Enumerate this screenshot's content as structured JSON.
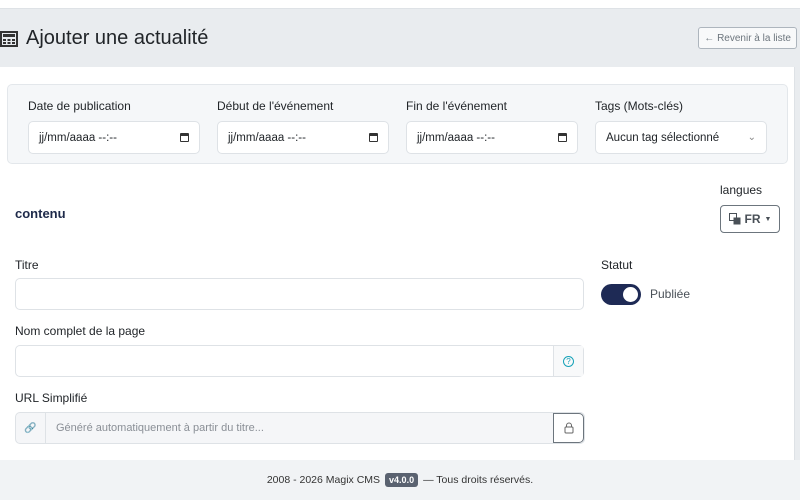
{
  "header": {
    "title": "Ajouter une actualité",
    "back_label": "← Revenir à la liste"
  },
  "filters": [
    {
      "label": "Date de publication",
      "value": "jj/mm/aaaa --:--",
      "icon": "calendar-icon"
    },
    {
      "label": "Début de l'événement",
      "value": "jj/mm/aaaa --:--",
      "icon": "calendar-icon"
    },
    {
      "label": "Fin de l'événement",
      "value": "jj/mm/aaaa --:--",
      "icon": "calendar-icon"
    },
    {
      "label": "Tags (Mots-clés)",
      "value": "Aucun tag sélectionné",
      "icon": "chevron-down-icon"
    }
  ],
  "content": {
    "section_title": "contenu",
    "languages_label": "langues",
    "language": "FR",
    "title_label": "Titre",
    "title_value": "",
    "fullname_label": "Nom complet de la page",
    "fullname_value": "",
    "url_label": "URL Simplifié",
    "url_placeholder": "Généré automatiquement à partir du titre...",
    "status_label": "Statut",
    "status_value": "Publiée",
    "status_on": true
  },
  "footer": {
    "text_before": "2008 - 2026 Magix CMS",
    "version": "v4.0.0",
    "text_after": "— Tous droits réservés."
  }
}
